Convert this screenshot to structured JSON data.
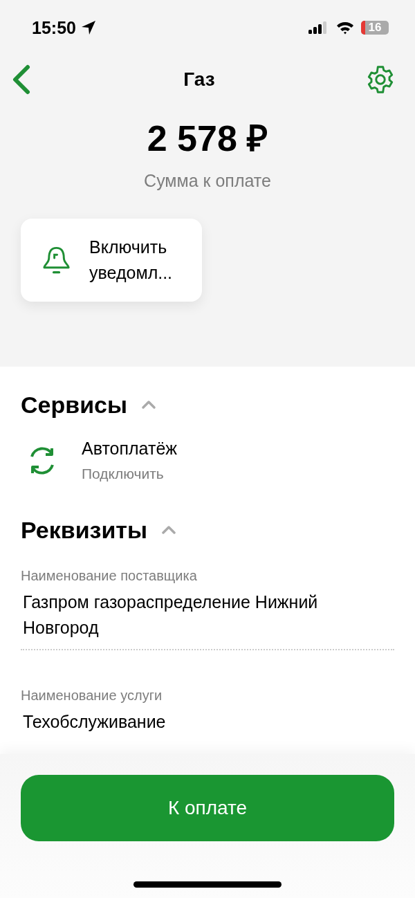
{
  "status_bar": {
    "time": "15:50",
    "battery": "16"
  },
  "nav": {
    "title": "Газ"
  },
  "amount": {
    "value": "2 578 ₽",
    "caption": "Сумма к оплате"
  },
  "notify_card": {
    "label": "Включить уведомл..."
  },
  "sections": [
    {
      "title": "Сервисы",
      "expanded": true,
      "kind": "services",
      "items": [
        {
          "title": "Автоплатёж",
          "subtitle": "Подключить"
        }
      ]
    },
    {
      "title": "Реквизиты",
      "expanded": true,
      "kind": "details",
      "items": [
        {
          "label": "Наименование поставщика",
          "value": "Газпром газораспределение Нижний Новгород"
        },
        {
          "label": "Наименование услуги",
          "value": "Техобслуживание"
        }
      ]
    }
  ],
  "pay_button": {
    "label": "К оплате"
  }
}
